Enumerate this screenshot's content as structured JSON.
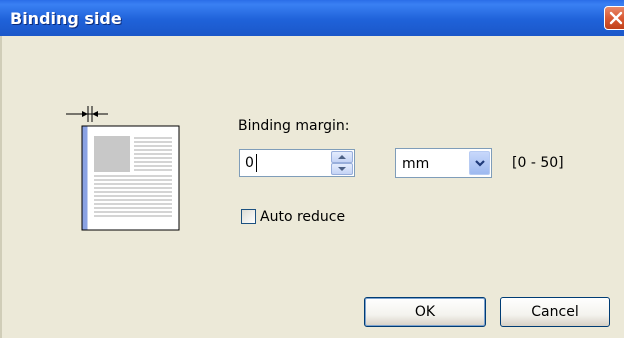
{
  "window": {
    "title": "Binding side"
  },
  "binding_margin": {
    "label": "Binding margin:",
    "value": "0",
    "unit_selected": "mm",
    "range": "[0 - 50]"
  },
  "auto_reduce": {
    "label": "Auto reduce",
    "checked": false
  },
  "buttons": {
    "ok": "OK",
    "cancel": "Cancel"
  },
  "icons": {
    "close": "close-icon",
    "preview": "binding-preview-icon",
    "spin_up": "spin-up-icon",
    "spin_down": "spin-down-icon",
    "dropdown": "chevron-down-icon"
  },
  "colors": {
    "titlebar": "#1F62D9",
    "dialog_bg": "#ECE9D8",
    "binding_edge": "#8AA2E3"
  }
}
